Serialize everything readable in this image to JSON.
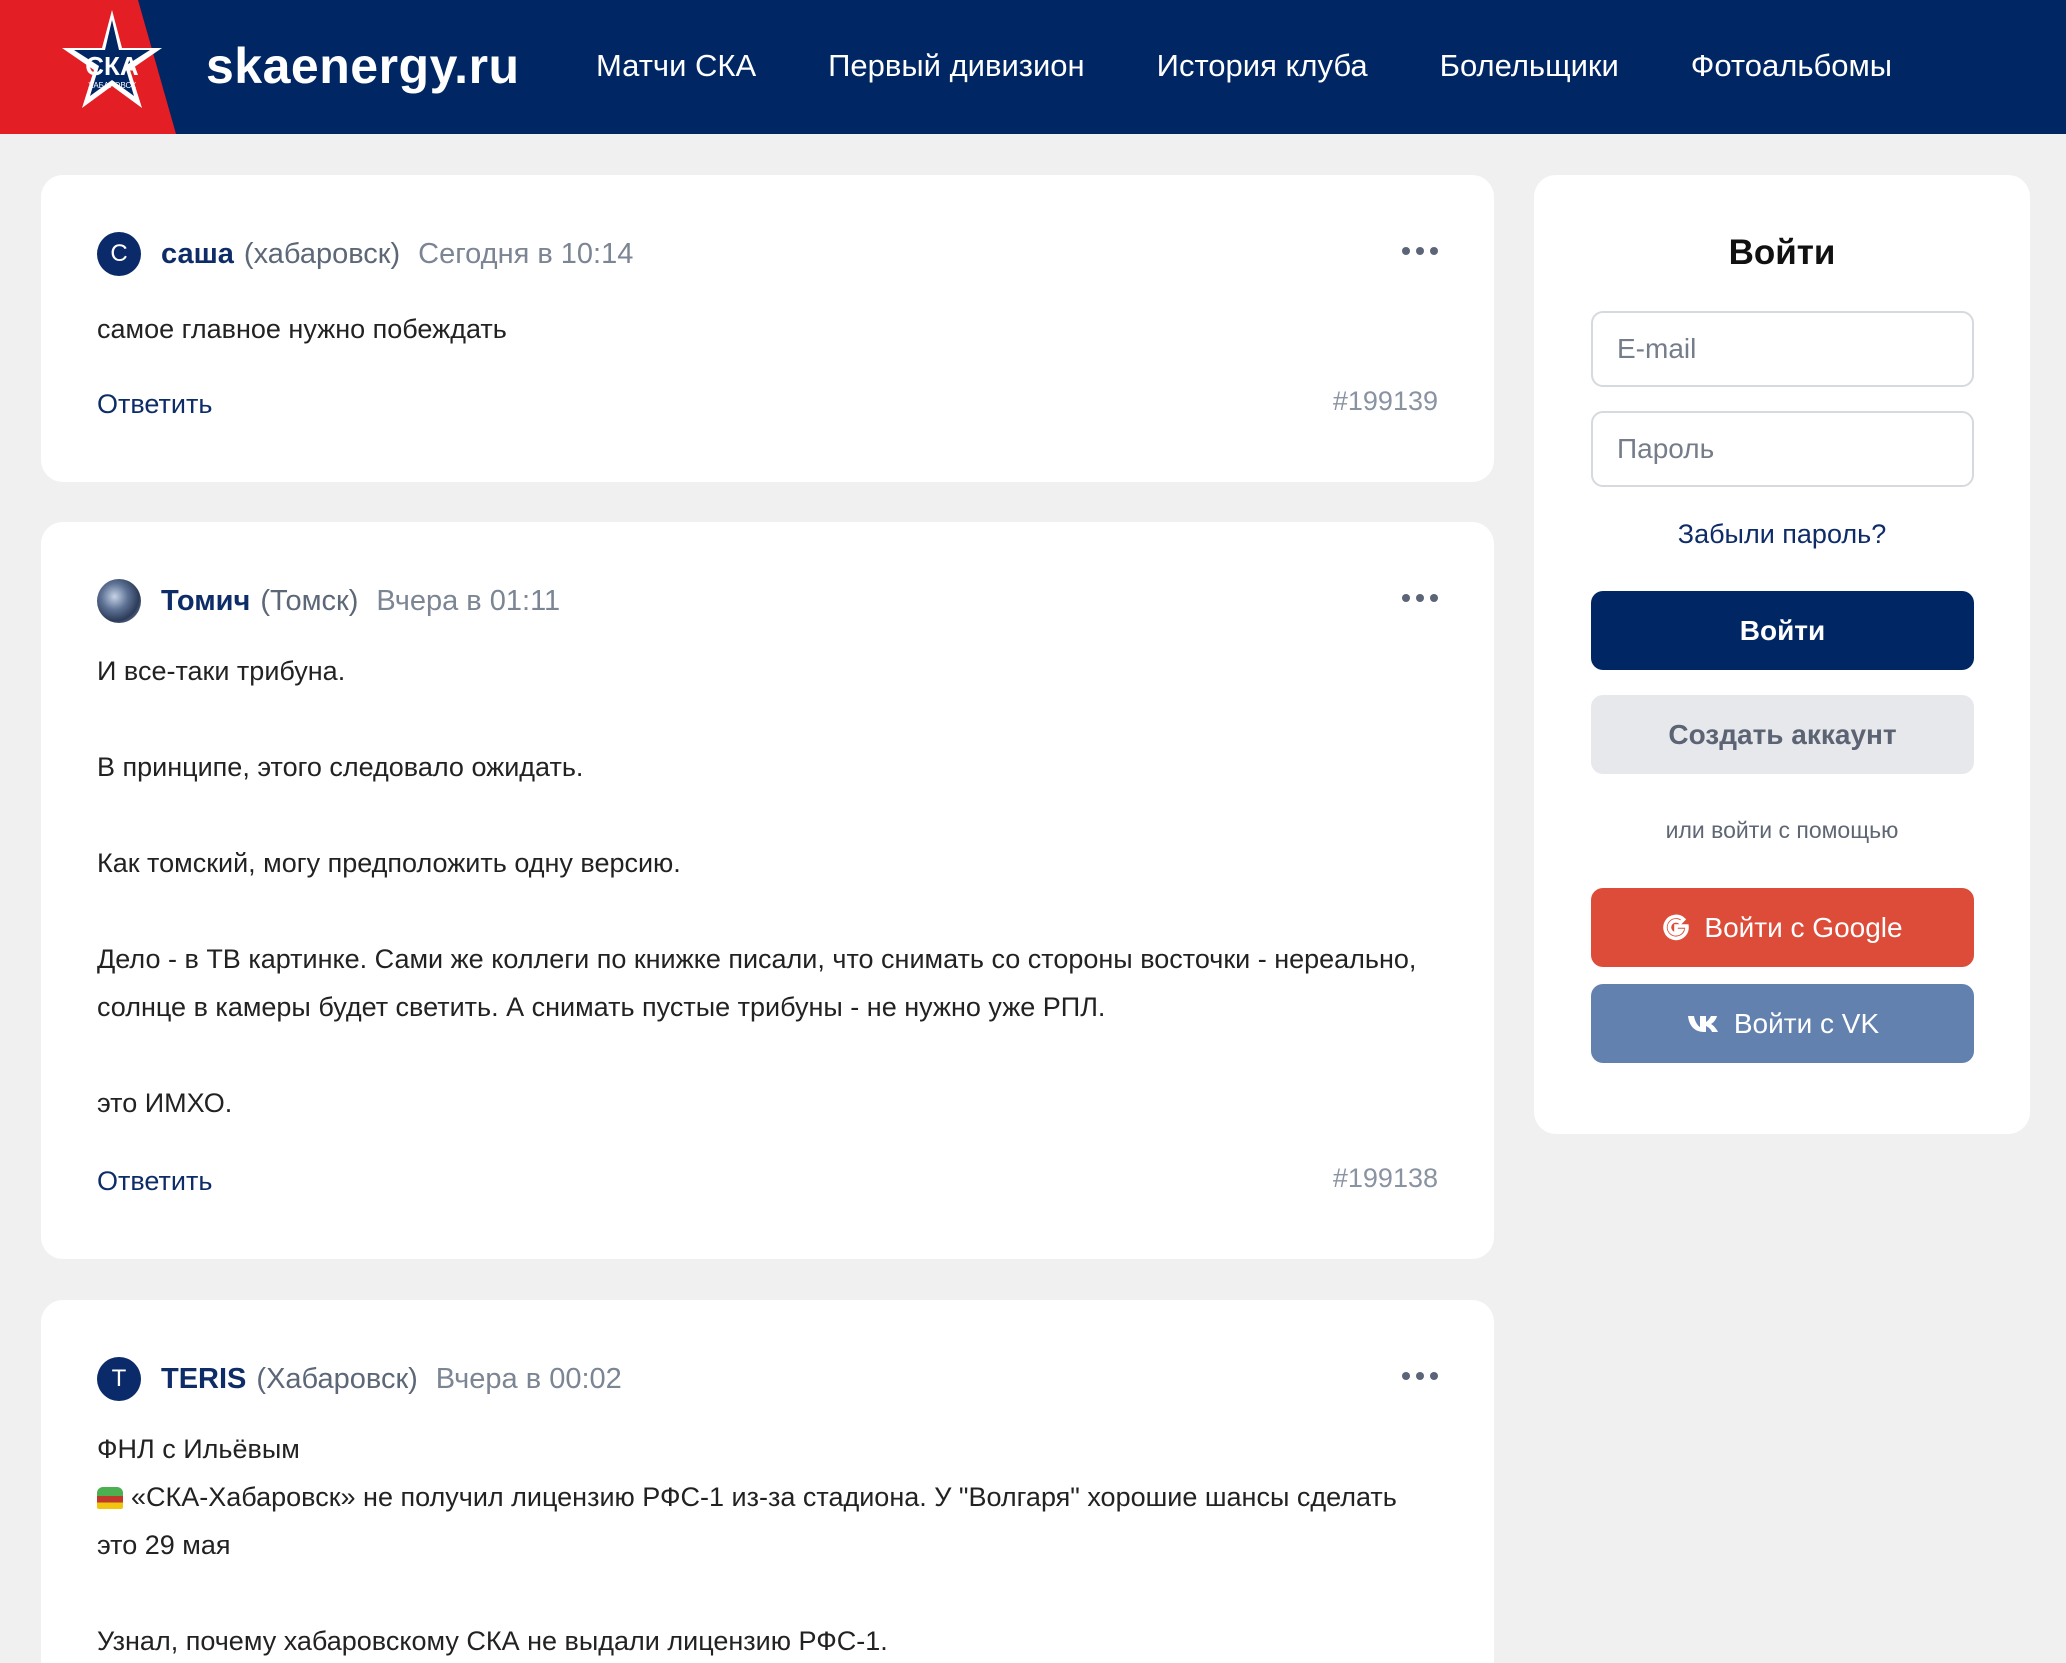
{
  "header": {
    "site_name": "skaenergy.ru",
    "logo_text": "СКА",
    "logo_subtext": "ХАБАРОВСК",
    "nav": [
      "Матчи СКА",
      "Первый дивизион",
      "История клуба",
      "Болельщики",
      "Фотоальбомы"
    ]
  },
  "posts": [
    {
      "avatar_letter": "С",
      "author": "саша",
      "city": "(хабаровск)",
      "time": "Сегодня в 10:14",
      "body": [
        "самое главное нужно побеждать"
      ],
      "reply_label": "Ответить",
      "id": "#199139"
    },
    {
      "avatar_letter": "",
      "author": "Томич",
      "city": "(Томск)",
      "time": "Вчера в 01:11",
      "body": [
        "И все-таки трибуна.",
        "В принципе, этого следовало ожидать.",
        "Как томский, могу предположить одну версию.",
        "Дело - в ТВ картинке. Сами же коллеги по книжке писали, что снимать со стороны восточки - нереально, солнце в камеры будет светить. А снимать пустые трибуны - не нужно уже РПЛ.",
        "это ИМХО."
      ],
      "reply_label": "Ответить",
      "id": "#199138"
    },
    {
      "avatar_letter": "T",
      "author": "TERIS",
      "city": "(Хабаровск)",
      "time": "Вчера в 00:02",
      "body": [
        "ФНЛ с Ильёвым",
        "«СКА-Хабаровск» не получил лицензию РФС-1 из-за стадиона. У \"Волгаря\" хорошие шансы сделать это 29 мая",
        "Узнал, почему хабаровскому СКА не выдали лицензию РФС-1."
      ]
    }
  ],
  "login": {
    "title": "Войти",
    "email_placeholder": "E-mail",
    "password_placeholder": "Пароль",
    "forgot": "Забыли пароль?",
    "login_button": "Войти",
    "create_button": "Создать аккаунт",
    "or_text": "или войти с помощью",
    "google_button": "Войти с Google",
    "vk_button": "Войти с VK"
  },
  "colors": {
    "header_bg": "#002664",
    "accent_red": "#e31e24",
    "google": "#dd4b39",
    "vk": "#6281ae"
  }
}
